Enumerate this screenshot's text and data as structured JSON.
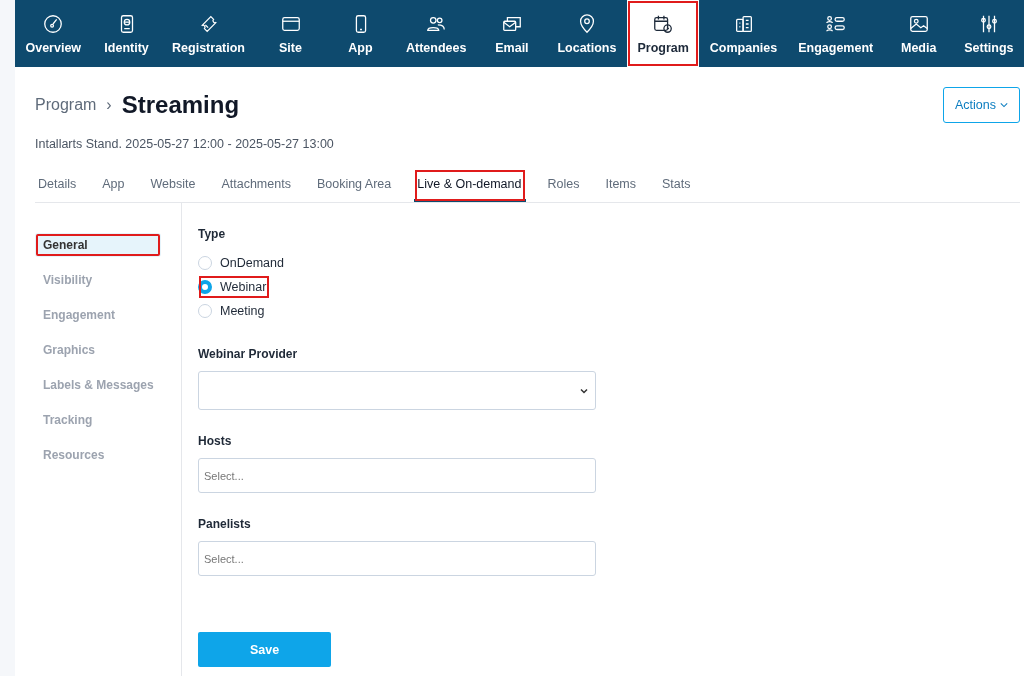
{
  "nav": [
    {
      "label": "Overview",
      "selected": false
    },
    {
      "label": "Identity",
      "selected": false
    },
    {
      "label": "Registration",
      "selected": false
    },
    {
      "label": "Site",
      "selected": false
    },
    {
      "label": "App",
      "selected": false
    },
    {
      "label": "Attendees",
      "selected": false
    },
    {
      "label": "Email",
      "selected": false
    },
    {
      "label": "Locations",
      "selected": false
    },
    {
      "label": "Program",
      "selected": true,
      "highlighted": true
    },
    {
      "label": "Companies",
      "selected": false
    },
    {
      "label": "Engagement",
      "selected": false
    },
    {
      "label": "Media",
      "selected": false
    },
    {
      "label": "Settings",
      "selected": false
    }
  ],
  "breadcrumb": {
    "parent": "Program",
    "separator": "›",
    "title": "Streaming"
  },
  "actions_button": "Actions",
  "subtitle": "Intallarts Stand. 2025-05-27 12:00 - 2025-05-27 13:00",
  "tabs": [
    {
      "label": "Details",
      "selected": false
    },
    {
      "label": "App",
      "selected": false
    },
    {
      "label": "Website",
      "selected": false
    },
    {
      "label": "Attachments",
      "selected": false
    },
    {
      "label": "Booking Area",
      "selected": false
    },
    {
      "label": "Live & On-demand",
      "selected": true,
      "highlighted": true
    },
    {
      "label": "Roles",
      "selected": false
    },
    {
      "label": "Items",
      "selected": false
    },
    {
      "label": "Stats",
      "selected": false
    }
  ],
  "side_menu": [
    {
      "label": "General",
      "selected": true,
      "highlighted": true
    },
    {
      "label": "Visibility",
      "selected": false
    },
    {
      "label": "Engagement",
      "selected": false
    },
    {
      "label": "Graphics",
      "selected": false
    },
    {
      "label": "Labels & Messages",
      "selected": false
    },
    {
      "label": "Tracking",
      "selected": false
    },
    {
      "label": "Resources",
      "selected": false
    }
  ],
  "type": {
    "label": "Type",
    "options": [
      {
        "label": "OnDemand",
        "selected": false
      },
      {
        "label": "Webinar",
        "selected": true,
        "highlighted": true
      },
      {
        "label": "Meeting",
        "selected": false
      }
    ]
  },
  "fields": [
    {
      "kind": "select",
      "label": "Webinar Provider"
    },
    {
      "kind": "multiselect",
      "label": "Hosts",
      "placeholder": "Select..."
    },
    {
      "kind": "multiselect",
      "label": "Panelists",
      "placeholder": "Select..."
    }
  ],
  "save_button": "Save"
}
